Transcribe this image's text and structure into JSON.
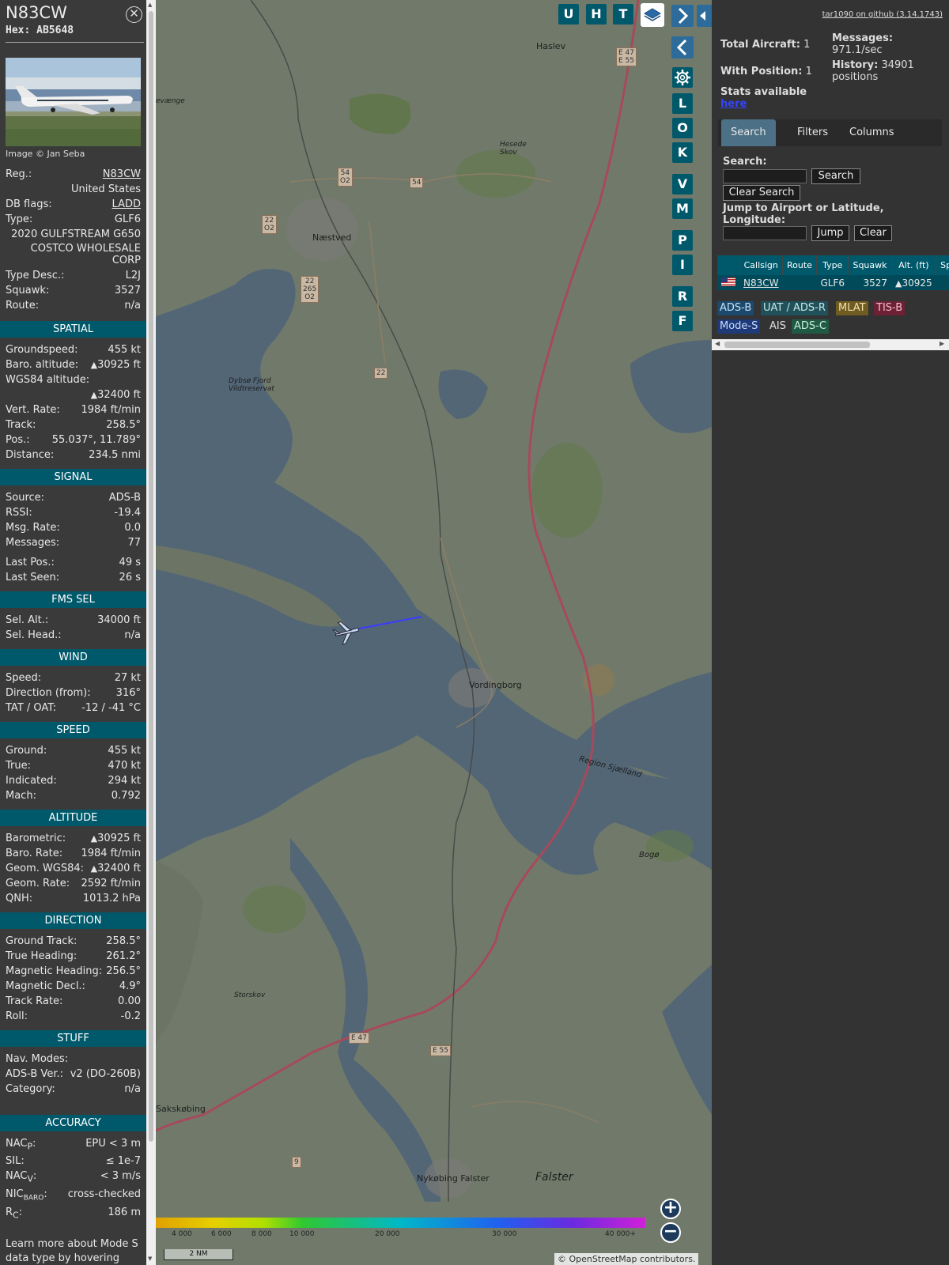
{
  "aircraft": {
    "callsign": "N83CW",
    "hex": "Hex: AB5648",
    "photo_credit": "Image © Jan Seba",
    "reg_label": "Reg.:",
    "reg": "N83CW",
    "country": "United States",
    "db_flags_label": "DB flags:",
    "db_flags": "LADD",
    "type_label": "Type:",
    "type": "GLF6",
    "model": "2020 GULFSTREAM G650",
    "owner": "COSTCO WHOLESALE CORP",
    "type_desc_label": "Type Desc.:",
    "type_desc": "L2J",
    "squawk_label": "Squawk:",
    "squawk": "3527",
    "route_label": "Route:",
    "route": "n/a"
  },
  "sections": {
    "spatial": "SPATIAL",
    "signal": "SIGNAL",
    "fms": "FMS SEL",
    "wind": "WIND",
    "speed": "SPEED",
    "altitude": "ALTITUDE",
    "direction": "DIRECTION",
    "stuff": "STUFF",
    "accuracy": "ACCURACY"
  },
  "spatial": {
    "groundspeed_label": "Groundspeed:",
    "groundspeed": "455 kt",
    "baro_label": "Baro. altitude:",
    "baro": "30925 ft",
    "wgs_label": "WGS84 altitude:",
    "wgs": "32400 ft",
    "vrate_label": "Vert. Rate:",
    "vrate": "1984 ft/min",
    "track_label": "Track:",
    "track": "258.5°",
    "pos_label": "Pos.:",
    "pos": "55.037°, 11.789°",
    "dist_label": "Distance:",
    "dist": "234.5 nmi"
  },
  "signal": {
    "source_label": "Source:",
    "source": "ADS-B",
    "rssi_label": "RSSI:",
    "rssi": "-19.4",
    "msgrate_label": "Msg. Rate:",
    "msgrate": "0.0",
    "messages_label": "Messages:",
    "messages": "77",
    "lastpos_label": "Last Pos.:",
    "lastpos": "49 s",
    "lastseen_label": "Last Seen:",
    "lastseen": "26 s"
  },
  "fms": {
    "selalt_label": "Sel. Alt.:",
    "selalt": "34000 ft",
    "selhead_label": "Sel. Head.:",
    "selhead": "n/a"
  },
  "wind": {
    "speed_label": "Speed:",
    "speed": "27 kt",
    "dir_label": "Direction (from):",
    "dir": "316°",
    "tat_label": "TAT / OAT:",
    "tat": "-12 / -41 °C"
  },
  "speed": {
    "ground_label": "Ground:",
    "ground": "455 kt",
    "true_label": "True:",
    "true": "470 kt",
    "ind_label": "Indicated:",
    "ind": "294 kt",
    "mach_label": "Mach:",
    "mach": "0.792"
  },
  "altitude": {
    "baro_label": "Barometric:",
    "baro": "30925 ft",
    "baro_rate_label": "Baro. Rate:",
    "baro_rate": "1984 ft/min",
    "geom_label": "Geom. WGS84:",
    "geom": "32400 ft",
    "geom_rate_label": "Geom. Rate:",
    "geom_rate": "2592 ft/min",
    "qnh_label": "QNH:",
    "qnh": "1013.2 hPa"
  },
  "direction": {
    "gt_label": "Ground Track:",
    "gt": "258.5°",
    "th_label": "True Heading:",
    "th": "261.2°",
    "mh_label": "Magnetic Heading:",
    "mh": "256.5°",
    "md_label": "Magnetic Decl.:",
    "md": "4.9°",
    "tr_label": "Track Rate:",
    "tr": "0.00",
    "roll_label": "Roll:",
    "roll": "-0.2"
  },
  "stuff": {
    "nav_label": "Nav. Modes:",
    "nav": "",
    "adsb_label": "ADS-B Ver.:",
    "adsb": "v2 (DO-260B)",
    "cat_label": "Category:",
    "cat": "n/a"
  },
  "accuracy": {
    "nacp_label": "NAC",
    "nacp_sub": "P",
    "nacp": "EPU < 3 m",
    "sil_label": "SIL:",
    "sil": "≤ 1e-7",
    "nacv_label": "NAC",
    "nacv_sub": "V",
    "nacv": "< 3 m/s",
    "nicbaro_label": "NIC",
    "nicbaro_sub": "BARO",
    "nicbaro": "cross-checked",
    "rc_label": "R",
    "rc_sub": "C",
    "rc": "186 m"
  },
  "footer_text": "Learn more about Mode S data type by hovering over",
  "map": {
    "buttons_top": [
      "U",
      "H",
      "T"
    ],
    "buttons_side": [
      "L",
      "O",
      "K",
      "V",
      "M",
      "P",
      "I",
      "R",
      "F"
    ],
    "places": [
      "Haslev",
      "Næstved",
      "Hesede Skov",
      "Dybsø Fjord Vildtreservat",
      "Vordingborg",
      "Region Sjælland",
      "Bogø",
      "Storskov",
      "Sakskøbing",
      "Nykøbing Falster",
      "Falster",
      "evænge"
    ],
    "colorbar_labels": [
      "4 000",
      "6 000",
      "8 000",
      "10 000",
      "20 000",
      "30 000",
      "40 000+"
    ],
    "scale": "2 NM",
    "attribution_prefix": "© ",
    "attribution_link": "OpenStreetMap",
    "attribution_suffix": " contributors."
  },
  "side": {
    "github": "tar1090 on github (3.14.1743)",
    "total_label": "Total Aircraft:",
    "total": "1",
    "withpos_label": "With Position:",
    "withpos": "1",
    "messages_label": "Messages:",
    "messages": "971.1/sec",
    "history_label": "History:",
    "history": "34901 positions",
    "stats_label": "Stats available",
    "stats_link": "here",
    "tabs": [
      "Search",
      "Filters",
      "Columns"
    ],
    "search_label": "Search:",
    "search_button": "Search",
    "clear_search_button": "Clear Search",
    "jump_label": "Jump to Airport or Latitude, Longitude:",
    "jump_button": "Jump",
    "clear_button": "Clear",
    "table_headers": [
      "",
      "Callsign",
      "Route",
      "Type",
      "Squawk",
      "Alt. (ft)",
      "Spd"
    ],
    "table_row": {
      "callsign": "N83CW",
      "route": "",
      "type": "GLF6",
      "squawk": "3527",
      "alt": "30925",
      "spd": ""
    },
    "badges": [
      "ADS-B",
      "UAT / ADS-R",
      "MLAT",
      "TIS-B",
      "Mode-S",
      "AIS",
      "ADS-C"
    ],
    "badge_colors": {
      "ADS-B": "#1c4a6e",
      "UAT / ADS-R": "#20505a",
      "MLAT": "#6e5c20",
      "TIS-B": "#6e2034",
      "Mode-S": "#1e3a78",
      "AIS": "#333333",
      "ADS-C": "#205a44"
    }
  }
}
